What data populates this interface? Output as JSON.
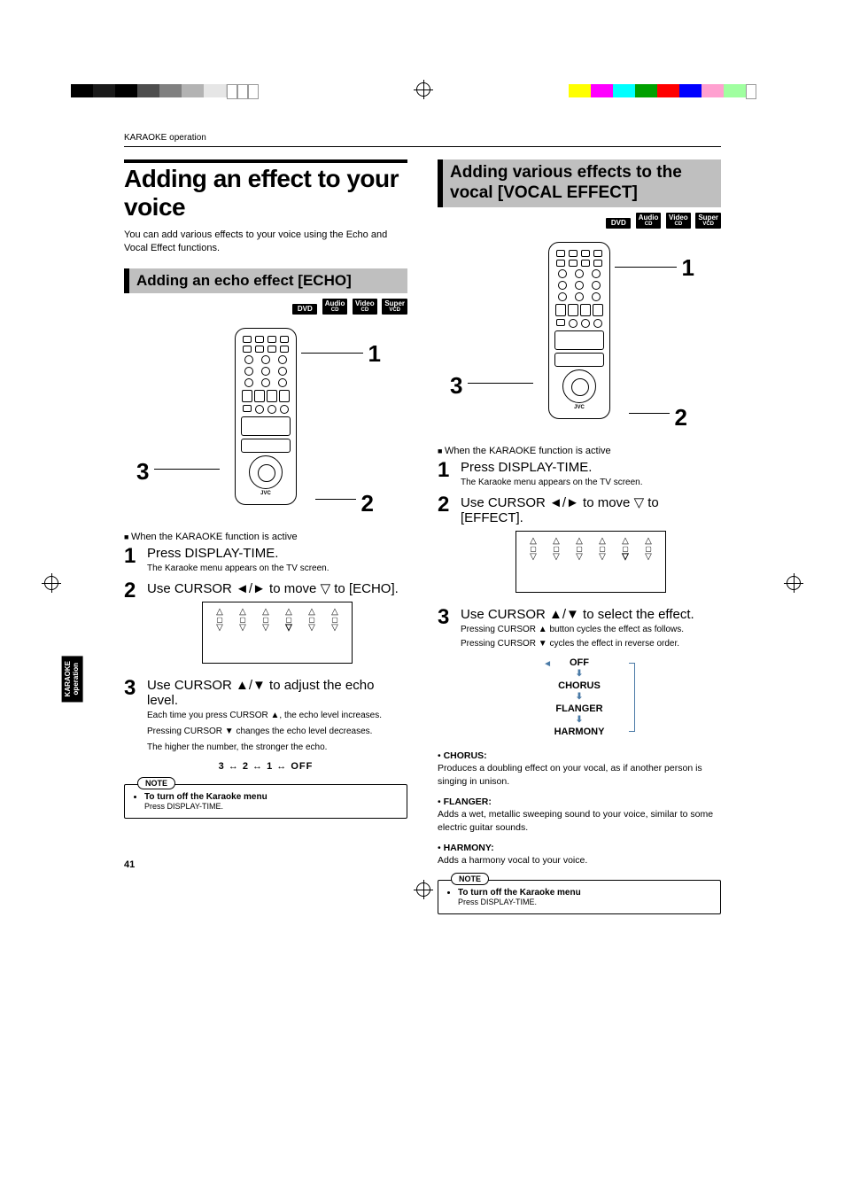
{
  "breadcrumb": "KARAOKE operation",
  "page_number": "41",
  "side_tab": "KARAOKE\noperation",
  "title": "Adding an effect to your voice",
  "intro": "You can add various effects to your voice using the Echo and Vocal Effect functions.",
  "echo": {
    "heading": "Adding an echo effect [ECHO]",
    "discs": [
      "DVD",
      "Audio CD",
      "Video CD",
      "Super VCD"
    ],
    "annot": {
      "a1": "1",
      "a2": "2",
      "a3": "3"
    },
    "remote_brand": "JVC",
    "when_active": "When the KARAOKE function is active",
    "steps": [
      {
        "num": "1",
        "head": "Press DISPLAY-TIME.",
        "body": "The Karaoke menu appears on the TV screen."
      },
      {
        "num": "2",
        "head": "Use CURSOR ◄/► to move ▽ to [ECHO].",
        "body": ""
      },
      {
        "num": "3",
        "head": "Use CURSOR ▲/▼ to adjust the echo level.",
        "body": ""
      }
    ],
    "step3_lines": [
      "Each time you press CURSOR ▲, the echo level increases.",
      "Pressing CURSOR ▼ changes the echo level decreases.",
      "The higher the number, the stronger the echo."
    ],
    "level_line": "3 ↔ 2 ↔ 1 ↔ OFF",
    "note_label": "NOTE",
    "note_title": "To turn off the Karaoke menu",
    "note_body": "Press DISPLAY-TIME."
  },
  "vocal": {
    "heading": "Adding various effects to the vocal [VOCAL EFFECT]",
    "discs": [
      "DVD",
      "Audio CD",
      "Video CD",
      "Super VCD"
    ],
    "annot": {
      "a1": "1",
      "a2": "2",
      "a3": "3"
    },
    "remote_brand": "JVC",
    "when_active": "When the KARAOKE function is active",
    "steps": [
      {
        "num": "1",
        "head": "Press DISPLAY-TIME.",
        "body": "The Karaoke menu appears on the TV screen."
      },
      {
        "num": "2",
        "head": "Use CURSOR ◄/► to move ▽ to [EFFECT].",
        "body": ""
      },
      {
        "num": "3",
        "head": "Use CURSOR ▲/▼ to select the effect.",
        "body": ""
      }
    ],
    "step3_lines": [
      "Pressing CURSOR ▲ button cycles the effect as follows.",
      "Pressing CURSOR ▼ cycles the effect in reverse order."
    ],
    "cycle": [
      "OFF",
      "CHORUS",
      "FLANGER",
      "HARMONY"
    ],
    "defs": [
      {
        "term": "CHORUS:",
        "desc": "Produces a doubling effect on your vocal, as if another person is singing in unison."
      },
      {
        "term": "FLANGER:",
        "desc": "Adds a wet, metallic sweeping sound to your voice, similar to some electric guitar sounds."
      },
      {
        "term": "HARMONY:",
        "desc": "Adds a harmony vocal to your voice."
      }
    ],
    "note_label": "NOTE",
    "note_title": "To turn off the Karaoke menu",
    "note_body": "Press DISPLAY-TIME."
  }
}
